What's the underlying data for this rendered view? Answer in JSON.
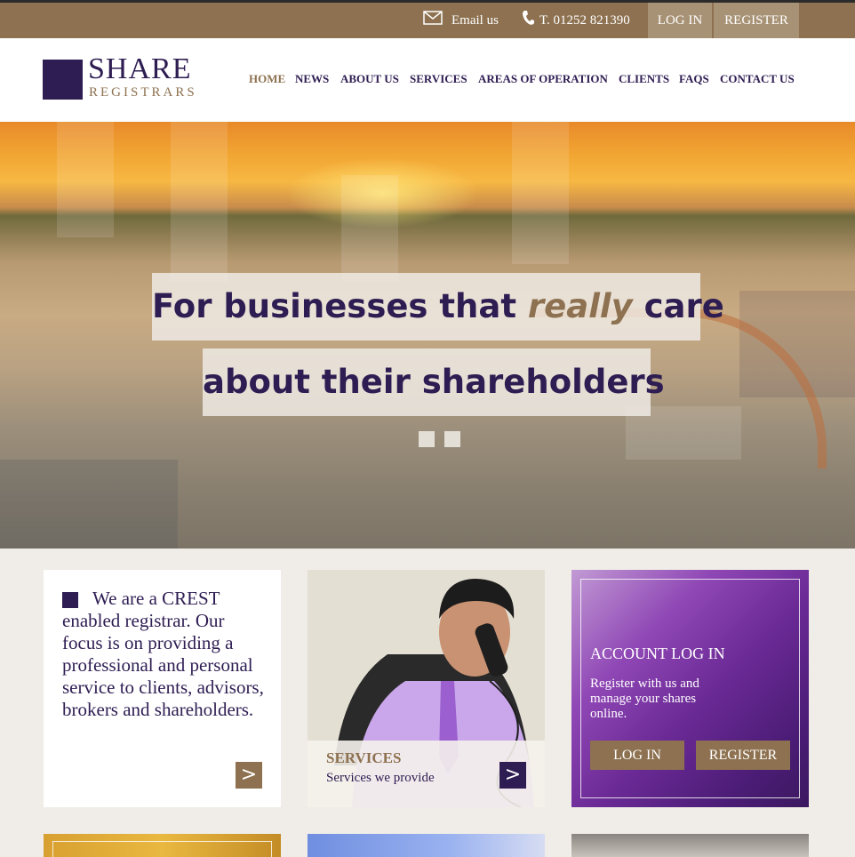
{
  "topbar": {
    "email_label": "Email us",
    "phone_label": "T. 01252 821390",
    "login_label": "LOG IN",
    "register_label": "REGISTER"
  },
  "logo": {
    "title": "SHARE",
    "subtitle": "REGISTRARS"
  },
  "nav": {
    "items": [
      "HOME",
      "NEWS",
      "ABOUT US",
      "SERVICES",
      "AREAS OF OPERATION",
      "CLIENTS",
      "FAQS",
      "CONTACT US"
    ],
    "active": "HOME"
  },
  "hero": {
    "line1_pre": "For businesses that ",
    "line1_em": "really",
    "line1_post": " care",
    "line2": "about their shareholders",
    "slide_count": 2
  },
  "cards": {
    "intro": {
      "text": "We are a CREST enabled registrar. Our focus is on providing a professional and personal service to clients, advisors, brokers and shareholders.",
      "arrow": ">"
    },
    "services": {
      "title": "SERVICES",
      "subtitle": "Services we provide",
      "arrow": ">"
    },
    "account": {
      "title": "ACCOUNT LOG IN",
      "text": "Register with us and manage your shares online.",
      "login_label": "LOG IN",
      "register_label": "REGISTER"
    }
  },
  "colors": {
    "brand_purple": "#2e1d52",
    "brand_gold": "#8d7150"
  }
}
